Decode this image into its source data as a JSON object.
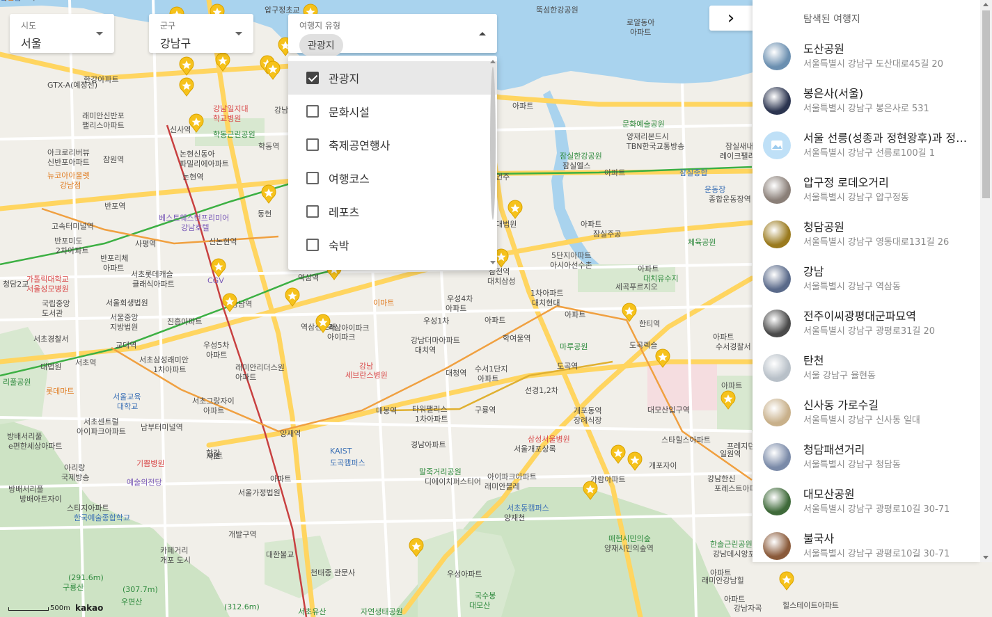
{
  "filters": {
    "sido": {
      "caption": "시도",
      "value": "서울"
    },
    "gungu": {
      "caption": "군구",
      "value": "강남구"
    },
    "type": {
      "caption": "여행지 유형",
      "chip": "관광지"
    }
  },
  "type_options": [
    {
      "label": "관광지",
      "checked": true
    },
    {
      "label": "문화시설",
      "checked": false
    },
    {
      "label": "축제공연행사",
      "checked": false
    },
    {
      "label": "여행코스",
      "checked": false
    },
    {
      "label": "레포츠",
      "checked": false
    },
    {
      "label": "숙박",
      "checked": false
    }
  ],
  "panel": {
    "toggle_icon": "chevron-right-icon",
    "toggle_glyph": "›",
    "title": "탐색된 여행지",
    "places": [
      {
        "name": "도산공원",
        "addr": "서울특별시 강남구 도산대로45길 20",
        "thumb": "#6b8fb0"
      },
      {
        "name": "봉은사(서울)",
        "addr": "서울특별시 강남구 봉은사로 531",
        "thumb": "#2c3550"
      },
      {
        "name": "서울 선릉(성종과 정현왕후)과 정릉(중종)",
        "addr": "서울특별시 강남구 선릉로100길 1",
        "thumb": "placeholder"
      },
      {
        "name": "압구정 로데오거리",
        "addr": "서울특별시 강남구 압구정동",
        "thumb": "#8a7f78"
      },
      {
        "name": "청담공원",
        "addr": "서울특별시 강남구 영동대로131길 26",
        "thumb": "#9a7a1e"
      },
      {
        "name": "강남",
        "addr": "서울특별시 강남구 역삼동",
        "thumb": "#5a6a8a"
      },
      {
        "name": "전주이씨광평대군파묘역",
        "addr": "서울특별시 강남구 광평로31길 20",
        "thumb": "#4a4a4a"
      },
      {
        "name": "탄천",
        "addr": "서울 강남구 율현동",
        "thumb": "#b8c0c8"
      },
      {
        "name": "신사동 가로수길",
        "addr": "서울특별시 강남구 신사동 일대",
        "thumb": "#c8b08a"
      },
      {
        "name": "청담패션거리",
        "addr": "서울특별시 강남구 청담동",
        "thumb": "#7a8aa8"
      },
      {
        "name": "대모산공원",
        "addr": "서울특별시 강남구 광평로10길 30-71",
        "thumb": "#3f6a3a"
      },
      {
        "name": "불국사",
        "addr": "서울특별시 강남구 광평로10길 30-71",
        "thumb": "#8a5a3a"
      }
    ]
  },
  "map": {
    "colors": {
      "land": "#f1efe9",
      "water": "#a9d3ee",
      "park": "#cde3c4",
      "road_major": "#ffd560",
      "road_minor": "#ffffff",
      "line_orange": "#f0a040",
      "line_green": "#3cb043",
      "line_red": "#c84040",
      "marker": "#f6c21b"
    },
    "labels": [
      {
        "t": "압구정초교",
        "k": "map-label"
      },
      {
        "t": "뚝섬한강공원",
        "k": "map-label"
      },
      {
        "t": "로얄동아",
        "k": "map-label"
      },
      {
        "t": "아파트",
        "k": "map-label"
      },
      {
        "t": "한강아파트",
        "k": "map-label"
      },
      {
        "t": "래미안신반포",
        "k": "map-label"
      },
      {
        "t": "팰리스아파트",
        "k": "map-label"
      },
      {
        "t": "강남일지대",
        "k": "map-label map-label-red"
      },
      {
        "t": "학교병원",
        "k": "map-label map-label-red"
      },
      {
        "t": "신사역",
        "k": "map-label"
      },
      {
        "t": "학동근린공원",
        "k": "map-label map-label-green"
      },
      {
        "t": "학동역",
        "k": "map-label"
      },
      {
        "t": "아크로리버뷰",
        "k": "map-label"
      },
      {
        "t": "신반포아파트",
        "k": "map-label"
      },
      {
        "t": "잠원역",
        "k": "map-label"
      },
      {
        "t": "논현신동아",
        "k": "map-label"
      },
      {
        "t": "파밀리에아파트",
        "k": "map-label"
      },
      {
        "t": "뉴코아아울렛",
        "k": "map-label map-label-orange"
      },
      {
        "t": "강남점",
        "k": "map-label map-label-orange"
      },
      {
        "t": "논현역",
        "k": "map-label"
      },
      {
        "t": "반포역",
        "k": "map-label"
      },
      {
        "t": "베스트웨스턴프리미어",
        "k": "map-label map-label-purple"
      },
      {
        "t": "강남호텔",
        "k": "map-label map-label-purple"
      },
      {
        "t": "고속터미널역",
        "k": "map-label"
      },
      {
        "t": "반포미도",
        "k": "map-label"
      },
      {
        "t": "2차아파트",
        "k": "map-label"
      },
      {
        "t": "사평역",
        "k": "map-label"
      },
      {
        "t": "신논현역",
        "k": "map-label"
      },
      {
        "t": "반포리체",
        "k": "map-label"
      },
      {
        "t": "아파트",
        "k": "map-label"
      },
      {
        "t": "서초롯데캐슬",
        "k": "map-label"
      },
      {
        "t": "클래식아파트",
        "k": "map-label"
      },
      {
        "t": "CGV",
        "k": "map-label map-label-purple"
      },
      {
        "t": "가톨릭대학교",
        "k": "map-label map-label-red"
      },
      {
        "t": "서울성모병원",
        "k": "map-label map-label-red"
      },
      {
        "t": "국립중앙",
        "k": "map-label"
      },
      {
        "t": "도서관",
        "k": "map-label"
      },
      {
        "t": "서울회생법원",
        "k": "map-label"
      },
      {
        "t": "서울중앙",
        "k": "map-label"
      },
      {
        "t": "지방법원",
        "k": "map-label"
      },
      {
        "t": "진흥아파트",
        "k": "map-label"
      },
      {
        "t": "강남역",
        "k": "map-label"
      },
      {
        "t": "역삼역",
        "k": "map-label"
      },
      {
        "t": "이마트",
        "k": "map-label map-label-orange"
      },
      {
        "t": "서초경찰서",
        "k": "map-label"
      },
      {
        "t": "교대역",
        "k": "map-label"
      },
      {
        "t": "우성5차",
        "k": "map-label"
      },
      {
        "t": "아파트",
        "k": "map-label"
      },
      {
        "t": "서초삼성래미안",
        "k": "map-label"
      },
      {
        "t": "1차아파트",
        "k": "map-label"
      },
      {
        "t": "대법원",
        "k": "map-label"
      },
      {
        "t": "서초역",
        "k": "map-label"
      },
      {
        "t": "래미안리더스원",
        "k": "map-label"
      },
      {
        "t": "아파트",
        "k": "map-label"
      },
      {
        "t": "역삼센트래",
        "k": "map-label"
      },
      {
        "t": "아이파크",
        "k": "map-label"
      },
      {
        "t": "역삼아이파크",
        "k": "map-label"
      },
      {
        "t": "강남",
        "k": "map-label map-label-red"
      },
      {
        "t": "세브란스병원",
        "k": "map-label map-label-red"
      },
      {
        "t": "서울교육",
        "k": "map-label map-label-blue"
      },
      {
        "t": "대학교",
        "k": "map-label map-label-blue"
      },
      {
        "t": "롯데마트",
        "k": "map-label map-label-orange"
      },
      {
        "t": "리풀공원",
        "k": "map-label map-label-green"
      },
      {
        "t": "서초그랑자이",
        "k": "map-label"
      },
      {
        "t": "아파트",
        "k": "map-label"
      },
      {
        "t": "서초센트럴",
        "k": "map-label"
      },
      {
        "t": "아이파크아파트",
        "k": "map-label"
      },
      {
        "t": "남부터미널역",
        "k": "map-label"
      },
      {
        "t": "양재역",
        "k": "map-label"
      },
      {
        "t": "방배서리풀",
        "k": "map-label"
      },
      {
        "t": "e편한세상아파트",
        "k": "map-label"
      },
      {
        "t": "KAIST",
        "k": "map-label map-label-blue"
      },
      {
        "t": "도곡캠퍼스",
        "k": "map-label map-label-blue"
      },
      {
        "t": "매봉역",
        "k": "map-label"
      },
      {
        "t": "타워팰리스",
        "k": "map-label"
      },
      {
        "t": "1차아파트",
        "k": "map-label"
      },
      {
        "t": "경남아파트",
        "k": "map-label"
      },
      {
        "t": "구룡역",
        "k": "map-label"
      },
      {
        "t": "아리랑",
        "k": "map-label"
      },
      {
        "t": "국제방송",
        "k": "map-label"
      },
      {
        "t": "기쁨병원",
        "k": "map-label map-label-red"
      },
      {
        "t": "예술의전당",
        "k": "map-label map-label-purple"
      },
      {
        "t": "방배서리풀",
        "k": "map-label"
      },
      {
        "t": "방배아트자이",
        "k": "map-label"
      },
      {
        "t": "아파트",
        "k": "map-label"
      },
      {
        "t": "서울가정법원",
        "k": "map-label"
      },
      {
        "t": "말죽거리공원",
        "k": "map-label map-label-green"
      },
      {
        "t": "디에이치퍼스티어",
        "k": "map-label"
      },
      {
        "t": "아이파크아파트",
        "k": "map-label"
      },
      {
        "t": "래미안블레",
        "k": "map-label"
      },
      {
        "t": "스티지아파트",
        "k": "map-label"
      },
      {
        "t": "한국예술종합학교",
        "k": "map-label map-label-blue"
      },
      {
        "t": "서초동캠퍼스",
        "k": "map-label map-label-blue"
      },
      {
        "t": "양재천",
        "k": "map-label"
      },
      {
        "t": "카페거리",
        "k": "map-label"
      },
      {
        "t": "개포 도시",
        "k": "map-label"
      },
      {
        "t": "개발구역",
        "k": "map-label"
      },
      {
        "t": "대한불교",
        "k": "map-label"
      },
      {
        "t": "천태종 관문사",
        "k": "map-label"
      },
      {
        "t": "우성아파트",
        "k": "map-label"
      },
      {
        "t": "매헌시민의숲",
        "k": "map-label map-label-green"
      },
      {
        "t": "양재시민의숲역",
        "k": "map-label"
      },
      {
        "t": "국수봉",
        "k": "map-label map-label-green"
      },
      {
        "t": "대모산",
        "k": "map-label map-label-green"
      },
      {
        "t": "(291.6m)",
        "k": "map-label map-label-green"
      },
      {
        "t": "구룡산",
        "k": "map-label map-label-green"
      },
      {
        "t": "(307.7m)",
        "k": "map-label map-label-green"
      },
      {
        "t": "우면산",
        "k": "map-label map-label-green"
      },
      {
        "t": "(312.6m)",
        "k": "map-label map-label-green"
      },
      {
        "t": "서초유산",
        "k": "map-label map-label-green"
      },
      {
        "t": "자연생태공원",
        "k": "map-label map-label-green"
      },
      {
        "t": "문화예술공원",
        "k": "map-label map-label-green"
      },
      {
        "t": "양재리본드시",
        "k": "map-label"
      },
      {
        "t": "TBN한국교통방송",
        "k": "map-label"
      },
      {
        "t": "잠실한강공원",
        "k": "map-label map-label-green"
      },
      {
        "t": "잠실엘스",
        "k": "map-label"
      },
      {
        "t": "아파트",
        "k": "map-label"
      },
      {
        "t": "잠실종합",
        "k": "map-label map-label-blue"
      },
      {
        "t": "운동장",
        "k": "map-label map-label-blue"
      },
      {
        "t": "종합운동장역",
        "k": "map-label"
      },
      {
        "t": "잠실새내역",
        "k": "map-label"
      },
      {
        "t": "레이크팰리스",
        "k": "map-label"
      },
      {
        "t": "아파트",
        "k": "map-label"
      },
      {
        "t": "잠실주공",
        "k": "map-label"
      },
      {
        "t": "5단지아파트",
        "k": "map-label"
      },
      {
        "t": "아시아선수촌",
        "k": "map-label"
      },
      {
        "t": "아파트",
        "k": "map-label"
      },
      {
        "t": "대치유수지",
        "k": "map-label map-label-green"
      },
      {
        "t": "체육공원",
        "k": "map-label map-label-green"
      },
      {
        "t": "우성4차",
        "k": "map-label"
      },
      {
        "t": "아파트",
        "k": "map-label"
      },
      {
        "t": "삼전역",
        "k": "map-label"
      },
      {
        "t": "대치삼성",
        "k": "map-label"
      },
      {
        "t": "1차아파트",
        "k": "map-label"
      },
      {
        "t": "대치현대",
        "k": "map-label"
      },
      {
        "t": "아파트",
        "k": "map-label"
      },
      {
        "t": "우성1차",
        "k": "map-label"
      },
      {
        "t": "아파트",
        "k": "map-label"
      },
      {
        "t": "학여울역",
        "k": "map-label"
      },
      {
        "t": "한티역",
        "k": "map-label"
      },
      {
        "t": "강남더마아파트",
        "k": "map-label"
      },
      {
        "t": "대치역",
        "k": "map-label"
      },
      {
        "t": "마루공원",
        "k": "map-label map-label-green"
      },
      {
        "t": "도곡렉슬",
        "k": "map-label"
      },
      {
        "t": "아파트",
        "k": "map-label"
      },
      {
        "t": "수서경찰서",
        "k": "map-label"
      },
      {
        "t": "대청역",
        "k": "map-label"
      },
      {
        "t": "수서1단지",
        "k": "map-label"
      },
      {
        "t": "아파트",
        "k": "map-label"
      },
      {
        "t": "도곡역",
        "k": "map-label"
      },
      {
        "t": "선경1,2차",
        "k": "map-label"
      },
      {
        "t": "아파트",
        "k": "map-label"
      },
      {
        "t": "대모산입구역",
        "k": "map-label"
      },
      {
        "t": "개포동역",
        "k": "map-label"
      },
      {
        "t": "장례식장",
        "k": "map-label"
      },
      {
        "t": "삼성서울병원",
        "k": "map-label map-label-red"
      },
      {
        "t": "서울개포상록",
        "k": "map-label"
      },
      {
        "t": "스타힐스아파트",
        "k": "map-label"
      },
      {
        "t": "개포자이",
        "k": "map-label"
      },
      {
        "t": "프레지던스아파트",
        "k": "map-label"
      },
      {
        "t": "일원역",
        "k": "map-label"
      },
      {
        "t": "가람아파트",
        "k": "map-label"
      },
      {
        "t": "강남한신",
        "k": "map-label"
      },
      {
        "t": "포레스트아파",
        "k": "map-label"
      },
      {
        "t": "한솔근린공원",
        "k": "map-label map-label-green"
      },
      {
        "t": "강남데시앙포레",
        "k": "map-label"
      },
      {
        "t": "아파트",
        "k": "map-label"
      },
      {
        "t": "래미안강남힐",
        "k": "map-label"
      },
      {
        "t": "아파트",
        "k": "map-label"
      },
      {
        "t": "강남자곡",
        "k": "map-label"
      },
      {
        "t": "힐스테이트아파트",
        "k": "map-label"
      },
      {
        "t": "세곡푸르지오",
        "k": "map-label"
      },
      {
        "t": "아파트",
        "k": "map-label"
      },
      {
        "t": "강남신동클래스",
        "k": "map-label"
      },
      {
        "t": "GTX-A(예정선)",
        "k": "map-label"
      },
      {
        "t": "청담2교",
        "k": "map-label"
      },
      {
        "t": "동헌",
        "k": "map-label"
      },
      {
        "t": "한강",
        "k": "map-label"
      },
      {
        "t": "이트",
        "k": "map-label"
      },
      {
        "t": "언주",
        "k": "map-label"
      },
      {
        "t": "대법원",
        "k": "map-label"
      },
      {
        "t": "서초",
        "k": "map-label"
      },
      {
        "t": "인센탈",
        "k": "map-label map-label-blue"
      },
      {
        "t": "화점",
        "k": "map-label map-label-orange"
      },
      {
        "t": "서초서초역",
        "k": "map-label"
      }
    ],
    "scale_label": "500m",
    "logo": "kakao"
  }
}
